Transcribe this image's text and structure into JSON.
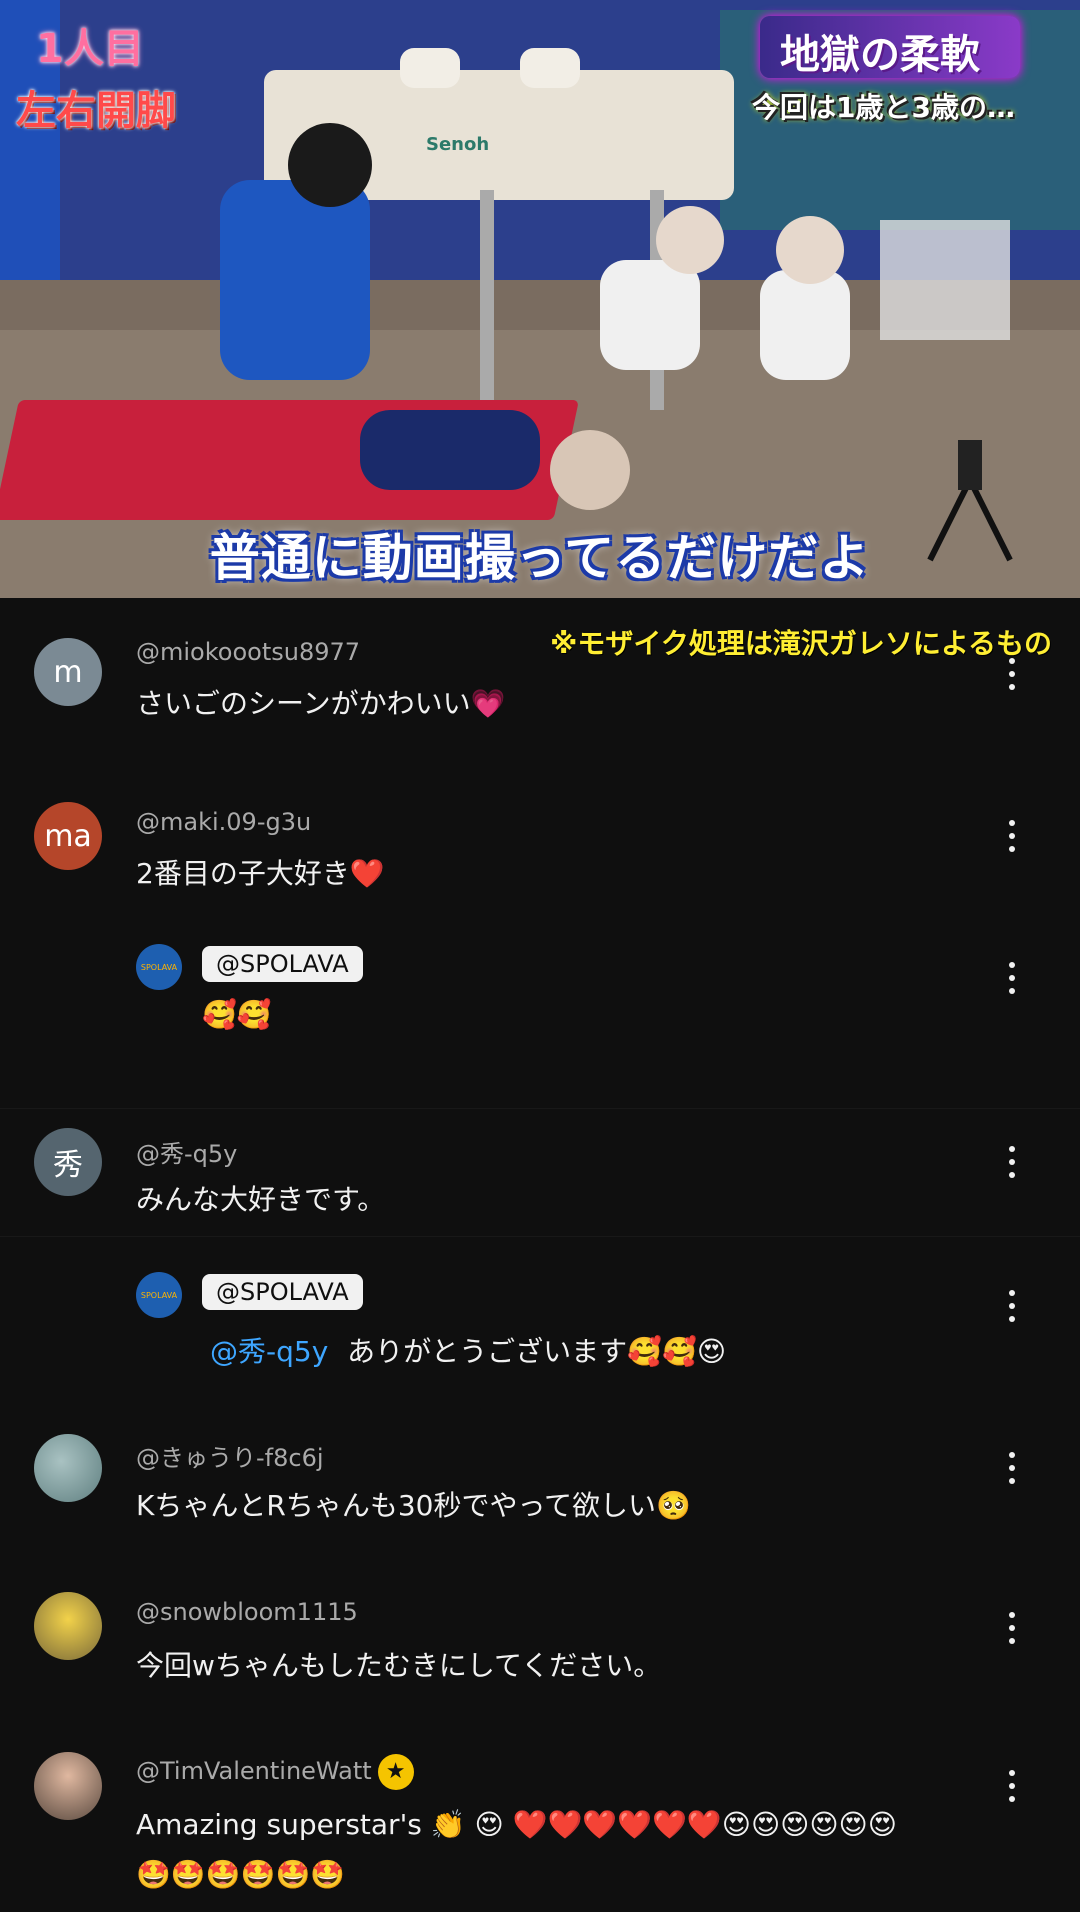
{
  "video": {
    "overlay_top_left_1": "1人目",
    "overlay_top_left_2": "左右開脚",
    "overlay_title": "地獄の柔軟",
    "overlay_subtitle": "今回は1歳と3歳の…",
    "equipment_brand": "Senoh",
    "caption": "普通に動画撮ってるだけだよ",
    "mosaic_note": "※モザイク処理は滝沢ガレソによるもの"
  },
  "comments": [
    {
      "avatar_letter": "m",
      "avatar_color": "#7b8a94",
      "handle": "@miokoootsu8977",
      "text": "さいごのシーンがかわいい💗"
    },
    {
      "avatar_letter": "ma",
      "avatar_color": "#b5462a",
      "handle": "@maki.09-g3u",
      "text": "2番目の子大好き❤️",
      "reply": {
        "channel": "@SPOLAVA",
        "avatar_text": "SPOLAVA",
        "text": "🥰🥰"
      }
    },
    {
      "avatar_letter": "秀",
      "avatar_color": "#55656f",
      "handle": "@秀-q5y",
      "text": "みんな大好きです。",
      "reply": {
        "channel": "@SPOLAVA",
        "avatar_text": "SPOLAVA",
        "mention": "@秀-q5y",
        "text": "ありがとうございます🥰🥰😍"
      }
    },
    {
      "avatar_letter": "",
      "avatar_color": "#6a8a8c",
      "handle": "@きゅうり-f8c6j",
      "text": "KちゃんとRちゃんも30秒でやって欲しい🥺"
    },
    {
      "avatar_letter": "",
      "avatar_color": "#c8b27a",
      "handle": "@snowbloom1115",
      "text": "今回wちゃんもしたむきにしてください。"
    },
    {
      "avatar_letter": "",
      "avatar_color": "#8a6c5c",
      "handle": "@TimValentineWatt",
      "badge": "★",
      "text": "Amazing superstar's 👏 😍 ❤️❤️❤️❤️❤️❤️😍😍😍😍😍😍",
      "text2": "🤩🤩🤩🤩🤩🤩"
    }
  ],
  "colors": {
    "background": "#0f0f0f",
    "mention": "#3ea6ff",
    "note": "#ffee33"
  }
}
